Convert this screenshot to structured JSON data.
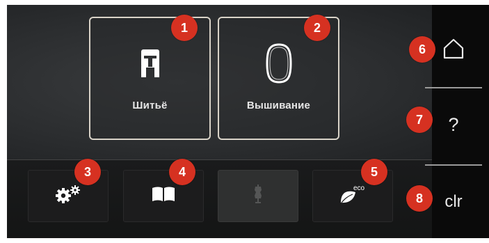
{
  "modes": [
    {
      "label": "Шитьё",
      "icon": "presser-foot-icon"
    },
    {
      "label": "Вышивание",
      "icon": "embroidery-hoop-icon"
    }
  ],
  "toolbar": [
    {
      "icon": "gears-icon",
      "enabled": true
    },
    {
      "icon": "book-icon",
      "enabled": true
    },
    {
      "icon": "dress-form-icon",
      "enabled": false
    },
    {
      "icon": "eco-leaf-icon",
      "enabled": true,
      "badge": "eco"
    }
  ],
  "sidebar": {
    "home_icon": "home-icon",
    "help_label": "?",
    "clear_label": "clr"
  },
  "callouts": [
    "1",
    "2",
    "3",
    "4",
    "5",
    "6",
    "7",
    "8"
  ],
  "colors": {
    "callout": "#d63121",
    "tile_border": "#d9d3c8",
    "background": "#0c0c0c"
  }
}
